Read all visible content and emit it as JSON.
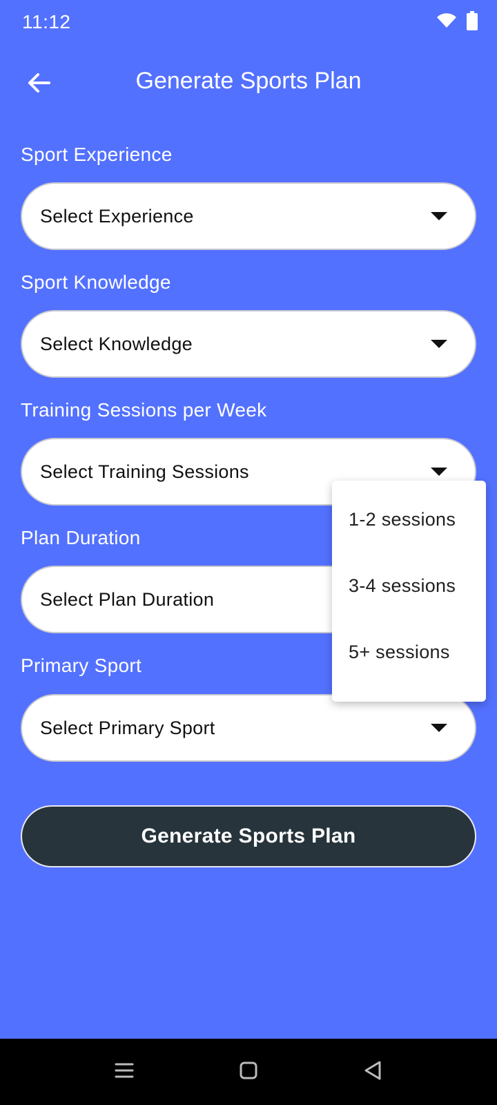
{
  "status_bar": {
    "time": "11:12",
    "icons": [
      "wifi-icon",
      "battery-icon"
    ]
  },
  "app_bar": {
    "back_icon": "arrow-left-icon",
    "title": "Generate Sports Plan"
  },
  "form": {
    "fields": [
      {
        "label": "Sport Experience",
        "placeholder": "Select Experience"
      },
      {
        "label": "Sport Knowledge",
        "placeholder": "Select Knowledge"
      },
      {
        "label": "Training Sessions per Week",
        "placeholder": "Select Training Sessions"
      },
      {
        "label": "Plan Duration",
        "placeholder": "Select Plan Duration"
      },
      {
        "label": "Primary Sport",
        "placeholder": "Select Primary Sport"
      }
    ]
  },
  "dropdown_menu": {
    "options": [
      "1-2 sessions",
      "3-4 sessions",
      "5+ sessions"
    ]
  },
  "generate_button": {
    "label": "Generate Sports Plan"
  },
  "nav_bar": {
    "icons": [
      "menu-icon",
      "home-icon",
      "back-icon"
    ]
  },
  "colors": {
    "background": "#5371FF",
    "button": "#27343B",
    "field": "#FFFFFF"
  }
}
